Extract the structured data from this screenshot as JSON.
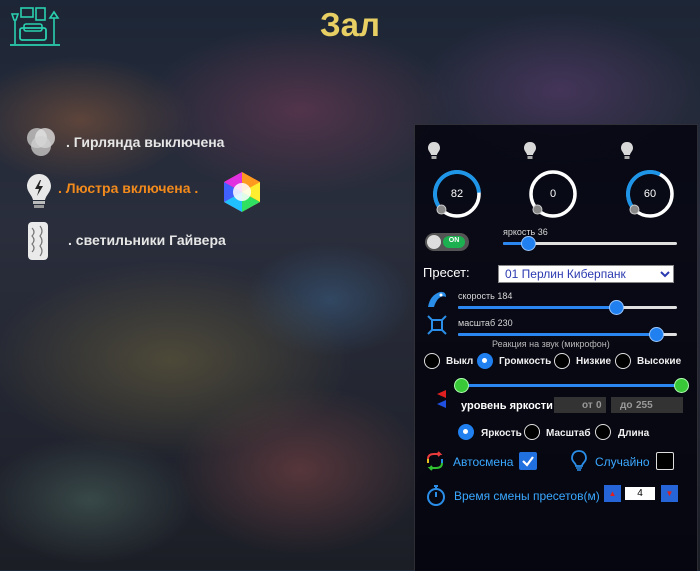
{
  "header": {
    "title": "Зал",
    "room_icon": "living-room-icon"
  },
  "devices": [
    {
      "label": ". Гирлянда выключена",
      "icon": "color-circles-icon",
      "state": "off"
    },
    {
      "label": ". Люстра включена .",
      "icon": "bulb-icon",
      "state": "on",
      "extra_icon": "color-hexagon-icon"
    },
    {
      "label": ". светильники Гайвера",
      "icon": "lamp-icon",
      "state": "neutral"
    }
  ],
  "panel": {
    "dials": [
      {
        "value": "82",
        "fill": 0.82,
        "icon": "bulb-icon"
      },
      {
        "value": "0",
        "fill": 0.0,
        "icon": "bulb-icon"
      },
      {
        "value": "60",
        "fill": 0.6,
        "icon": "bulb-icon"
      }
    ],
    "power_toggle": {
      "label": "ON",
      "on": true
    },
    "brightness": {
      "label": "яркость 36",
      "value": 36,
      "max": 255
    },
    "preset": {
      "label": "Пресет:",
      "selected": "01 Перлин Киберпанк"
    },
    "speed": {
      "label": "скорость 184",
      "value": 184,
      "max": 255
    },
    "scale": {
      "label": "масштаб 230",
      "value": 230,
      "max": 255
    },
    "sound": {
      "caption": "Реакция на звук (микрофон)",
      "options": [
        "Выкл",
        "Громкость",
        "Низкие",
        "Высокие"
      ],
      "selected": 1
    },
    "brightness_range": {
      "label": "уровень яркости:",
      "from_label": "от",
      "from_value": "0",
      "to_label": "до",
      "to_value": "255"
    },
    "mode": {
      "options": [
        "Яркость",
        "Масштаб",
        "Длина"
      ],
      "selected": 0
    },
    "auto_change": {
      "label": "Автосмена",
      "checked": true
    },
    "random": {
      "label": "Случайно",
      "checked": false
    },
    "change_time": {
      "label": "Время смены пресетов(м)",
      "value": "4",
      "minus": "▲",
      "plus": "▼"
    }
  },
  "colors": {
    "accent": "#2080f0",
    "title": "#e8cf64",
    "on_state": "#f28a1c",
    "label_blue": "#3aa8ff"
  }
}
